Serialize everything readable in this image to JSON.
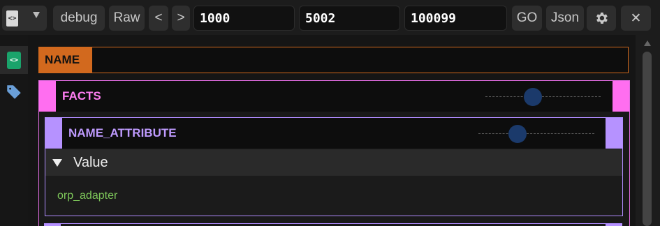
{
  "toolbar": {
    "debug_label": "debug",
    "raw_label": "Raw",
    "prev_label": "<",
    "next_label": ">",
    "input1_value": "1000",
    "input2_value": "5002",
    "input3_value": "100099",
    "go_label": "GO",
    "json_label": "Json",
    "close_label": "✕",
    "settings_icon": "gear-icon",
    "file_icon": "file-code-icon"
  },
  "sidebar": {
    "items": [
      {
        "icon": "file-code-icon",
        "active": true
      },
      {
        "icon": "tag-icon",
        "active": false
      }
    ]
  },
  "tree": {
    "name_label": "NAME",
    "facts_label": "FACTS",
    "attribute_label": "NAME_ATTRIBUTE",
    "value_label": "Value",
    "value_text": "orp_adapter"
  },
  "colors": {
    "name_accent": "#d2691e",
    "facts_accent": "#ff6ef0",
    "attribute_accent": "#b692ff",
    "value_text": "#7ec85a",
    "slider_knob": "#1b3a6b",
    "sidebar_active_icon": "#1aa36b",
    "tag_icon": "#6a9fd8"
  }
}
